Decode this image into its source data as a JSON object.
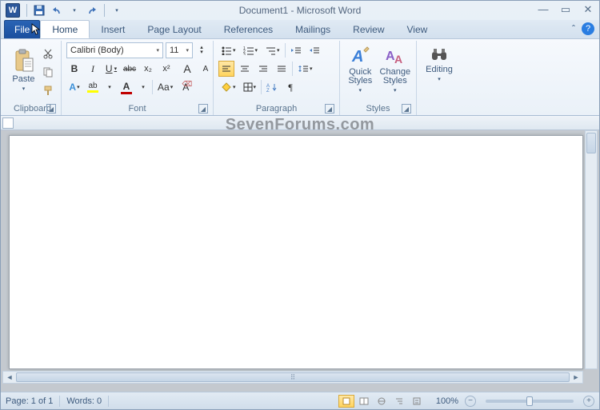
{
  "title": "Document1  -  Microsoft Word",
  "watermark": "SevenForums.com",
  "app_letter": "W",
  "tabs": {
    "file": "File",
    "home": "Home",
    "insert": "Insert",
    "page_layout": "Page Layout",
    "references": "References",
    "mailings": "Mailings",
    "review": "Review",
    "view": "View"
  },
  "help_glyph": "?",
  "minimize_ribbon_glyph": "ˆ",
  "ribbon": {
    "clipboard": {
      "label": "Clipboard",
      "paste": "Paste"
    },
    "font": {
      "label": "Font",
      "name": "Calibri (Body)",
      "size": "11",
      "bold": "B",
      "italic": "I",
      "underline": "U",
      "strike": "abc",
      "subscript": "x₂",
      "superscript": "x²",
      "grow": "A",
      "shrink": "A",
      "case": "Aa",
      "clear": "A"
    },
    "paragraph": {
      "label": "Paragraph"
    },
    "styles": {
      "label": "Styles",
      "quick": "Quick Styles",
      "change": "Change Styles"
    },
    "editing": {
      "label": "Editing"
    }
  },
  "status": {
    "page": "Page: 1 of 1",
    "words": "Words: 0",
    "zoom": "100%",
    "minus": "−",
    "plus": "+"
  },
  "caret": "▾",
  "caret_up": "▴"
}
